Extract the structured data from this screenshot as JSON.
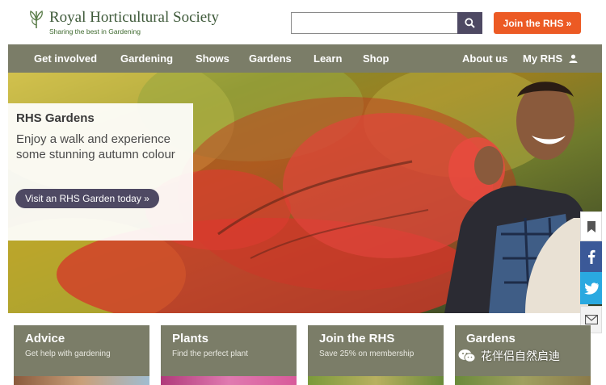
{
  "header": {
    "logo_title": "Royal Horticultural Society",
    "logo_tagline": "Sharing the best in Gardening",
    "search_value": "",
    "search_placeholder": "",
    "join_label": "Join the RHS »"
  },
  "nav": {
    "items": [
      "Get involved",
      "Gardening",
      "Shows",
      "Gardens",
      "Learn",
      "Shop"
    ],
    "right_items": [
      "About us",
      "My RHS"
    ]
  },
  "hero": {
    "title": "RHS Gardens",
    "body": "Enjoy a walk and experience some stunning autumn colour",
    "cta": "Visit an RHS Garden today »"
  },
  "cards": [
    {
      "title": "Advice",
      "subtitle": "Get help with gardening"
    },
    {
      "title": "Plants",
      "subtitle": "Find the perfect plant"
    },
    {
      "title": "Join the RHS",
      "subtitle": "Save 25% on membership"
    },
    {
      "title": "Gardens",
      "subtitle": ""
    }
  ],
  "share": {
    "icons": [
      "bookmark-icon",
      "facebook-icon",
      "twitter-icon",
      "mail-icon"
    ]
  },
  "watermark": {
    "text": "花伴侣自然启迪"
  },
  "colors": {
    "nav_bg": "#7b7d68",
    "join_orange": "#ec5a24",
    "cta_purple": "#4e4963",
    "facebook": "#3b5998",
    "twitter": "#2aa9e0"
  }
}
